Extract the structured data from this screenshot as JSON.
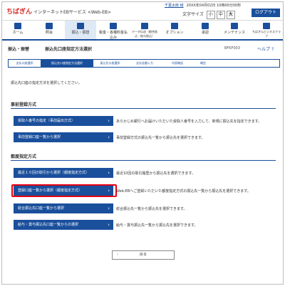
{
  "header": {
    "logo": "ちばぎん",
    "service": "インターネットEBサービス <Web-EB>",
    "user_name": "千葉太郎 様",
    "last_login": "20XX年04月02日 10時00分00秒",
    "text_size_label": "文字サイズ",
    "sizes": [
      "小",
      "中",
      "大"
    ],
    "logout": "ログアウト"
  },
  "nav": [
    {
      "label": "ホーム",
      "icon": "home-icon"
    },
    {
      "label": "照会",
      "icon": "inquiry-icon"
    },
    {
      "label": "振込・振替",
      "icon": "transfer-icon"
    },
    {
      "label": "税金・各種料金払込み",
      "icon": "tax-icon"
    },
    {
      "label": "データ伝送（総合振込・給与振込）",
      "icon": "data-icon"
    },
    {
      "label": "オプション",
      "icon": "option-icon"
    },
    {
      "label": "承認",
      "icon": "approve-icon"
    },
    {
      "label": "メンテナンス",
      "icon": "maintenance-icon"
    },
    {
      "label": "ちばぎんビジネスクラブ",
      "icon": "club-icon"
    }
  ],
  "title": {
    "crumb": "振込・振替",
    "page": "振込先口座指定方法選択",
    "code": "BFKF003",
    "help": "ヘルプ"
  },
  "steps": [
    "支払口座選択",
    "振込先口座指定方法選択",
    "振込先口座選択",
    "支払金額入力",
    "内容確認",
    "確定"
  ],
  "note": "振込先口座の指定方法を選択してください。",
  "sec1": {
    "title": "事前登録方式",
    "buttons": [
      {
        "label": "受取人番号の指定（事前届出方式）",
        "desc": "あらかじめ銀行へお届けいただいた受取人番号を入力して、新規に振込先を指定できます。"
      },
      {
        "label": "事前登録口座一覧から選択",
        "desc": "事前登録方式の振込先一覧から振込先を選択できます。"
      }
    ]
  },
  "sec2": {
    "title": "都度指定方式",
    "buttons": [
      {
        "label": "最近１０回の取引から選択（都度指定方式）",
        "desc": "最近10回の取引履歴から振込先を選択できます。"
      },
      {
        "label": "登録口座一覧から選択（都度指定方式）",
        "desc": "Web-EBへご登録いただいた都度指定方式の振込先一覧から振込先を選択できます。"
      },
      {
        "label": "総合振込先口座一覧から選択",
        "desc": "総合振込先一覧から振込先を選択できます。"
      },
      {
        "label": "給与・賞与振込先口座一覧からの選択",
        "desc": "給与・賞与振込先一覧から振込先を選択できます。"
      }
    ]
  },
  "back": "戻る",
  "colors": {
    "brand": "#1a4f9c",
    "logo_red": "#d9302b",
    "highlight": "#e60012"
  }
}
